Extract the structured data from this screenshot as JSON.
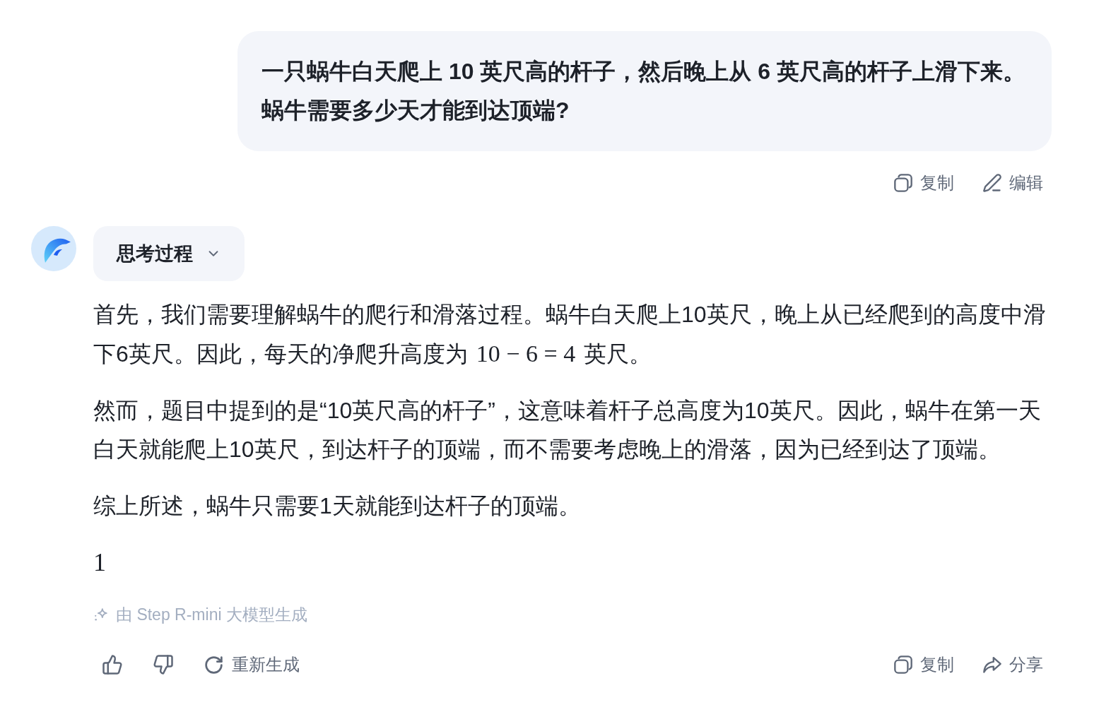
{
  "user_message": {
    "text": "一只蜗牛白天爬上 10 英尺高的杆子，然后晚上从 6 英尺高的杆子上滑下来。蜗牛需要多少天才能到达顶端?"
  },
  "user_actions": [
    {
      "kind": "copy",
      "label": "复制"
    },
    {
      "kind": "edit",
      "label": "编辑"
    }
  ],
  "assistant": {
    "thinking": {
      "label": "思考过程",
      "expanded": false
    },
    "paragraphs": [
      {
        "segments": [
          {
            "kind": "text",
            "text": "首先，我们需要理解蜗牛的爬行和滑落过程。蜗牛白天爬上10英尺，晚上从已经爬到的高度中滑下6英尺。因此，每天的净爬升高度为"
          },
          {
            "kind": "math",
            "text": "10 − 6 = 4"
          },
          {
            "kind": "text",
            "text": "英尺。"
          }
        ]
      },
      {
        "segments": [
          {
            "kind": "text",
            "text": "然而，题目中提到的是“10英尺高的杆子”，这意味着杆子总高度为10英尺。因此，蜗牛在第一天白天就能爬上10英尺，到达杆子的顶端，而不需要考虑晚上的滑落，因为已经到达了顶端。"
          }
        ]
      },
      {
        "segments": [
          {
            "kind": "text",
            "text": "综上所述，蜗牛只需要1天就能到达杆子的顶端。"
          }
        ]
      }
    ],
    "answer": "1",
    "model_note": "由 Step R-mini 大模型生成",
    "feedback_actions": [
      {
        "kind": "like"
      },
      {
        "kind": "dislike"
      },
      {
        "kind": "regenerate",
        "label": "重新生成"
      }
    ],
    "message_actions": [
      {
        "kind": "copy",
        "label": "复制"
      },
      {
        "kind": "share",
        "label": "分享"
      }
    ]
  }
}
